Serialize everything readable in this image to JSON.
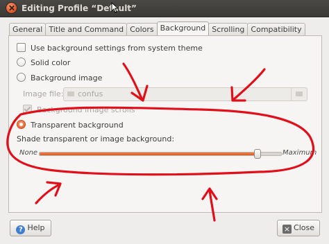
{
  "window": {
    "title": "Editing Profile “Default”"
  },
  "tabs": [
    {
      "label": "General"
    },
    {
      "label": "Title and Command"
    },
    {
      "label": "Colors"
    },
    {
      "label": "Background",
      "active": true
    },
    {
      "label": "Scrolling"
    },
    {
      "label": "Compatibility"
    }
  ],
  "background": {
    "use_system_label": "Use background settings from system theme",
    "use_system_checked": false,
    "solid_label": "Solid color",
    "image_label": "Background image",
    "image_file_label": "Image file:",
    "image_file_value": "confus",
    "scrolls_label": "Background image scrolls",
    "scrolls_checked": true,
    "transparent_label": "Transparent background",
    "selected": "transparent",
    "shade_label": "Shade transparent or image background:",
    "shade_min_label": "None",
    "shade_max_label": "Maximum",
    "shade_value": 0.9
  },
  "buttons": {
    "help": "Help",
    "close": "Close"
  },
  "colors": {
    "accent": "#e86a32",
    "annotation": "#e0101b"
  }
}
